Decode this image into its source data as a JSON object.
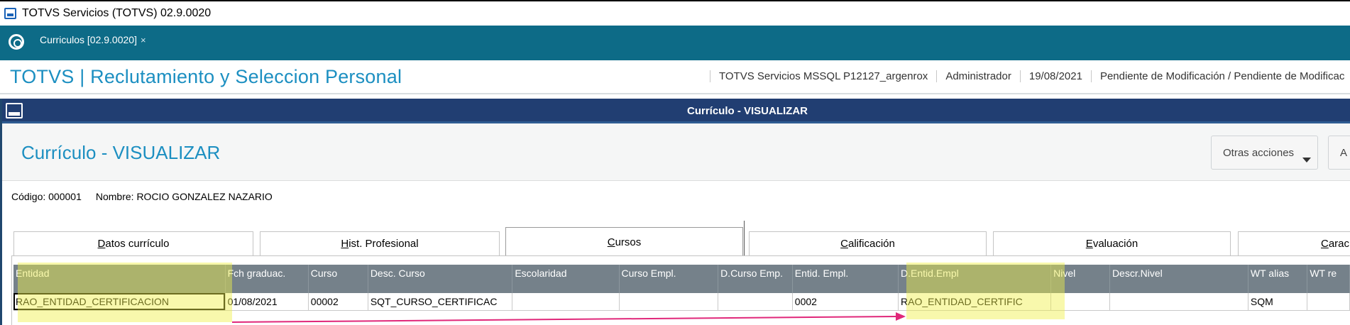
{
  "window": {
    "title": "TOTVS Servicios (TOTVS) 02.9.0020"
  },
  "tabs": [
    {
      "label": "Curriculos [02.9.0020]",
      "close": "×"
    }
  ],
  "header": {
    "app_title": "TOTVS | Reclutamiento y Seleccion Personal",
    "environment": "TOTVS Servicios MSSQL P12127_argenrox",
    "user": "Administrador",
    "date": "19/08/2021",
    "status": "Pendiente de Modificación / Pendiente de Modificac"
  },
  "dialog": {
    "title": "Currículo - VISUALIZAR",
    "form_title": "Currículo - VISUALIZAR",
    "buttons": {
      "otras_acciones": "Otras acciones",
      "a": "A"
    },
    "record": {
      "codigo": "Código: 000001",
      "nombre": "Nombre: ROCIO GONZALEZ NAZARIO"
    }
  },
  "folder_tabs": [
    {
      "pre": "",
      "key": "D",
      "post": "atos currículo",
      "active": false
    },
    {
      "pre": "",
      "key": "H",
      "post": "ist. Profesional",
      "active": false
    },
    {
      "pre": "",
      "key": "C",
      "post": "ursos",
      "active": true
    },
    {
      "pre": "",
      "key": "C",
      "post": "alificación",
      "active": false
    },
    {
      "pre": "",
      "key": "E",
      "post": "valuación",
      "active": false
    },
    {
      "pre": "",
      "key": "C",
      "post": "arac",
      "active": false
    }
  ],
  "grid": {
    "columns": [
      "Entidad",
      "Fch graduac.",
      "Curso",
      "Desc. Curso",
      "Escolaridad",
      "Curso Empl.",
      "D.Curso Emp.",
      "Entid. Empl.",
      "D.Entid.Empl",
      "Nivel",
      "Descr.Nivel",
      "WT alias",
      "WT re"
    ],
    "rows": [
      [
        "RAO_ENTIDAD_CERTIFICACION",
        "01/08/2021",
        "00002",
        "SQT_CURSO_CERTIFICAC",
        "",
        "",
        "",
        "0002",
        "RAO_ENTIDAD_CERTIFIC",
        "",
        "",
        "SQM",
        ""
      ]
    ]
  },
  "colors": {
    "tabstrip": "#0d6b87",
    "dialog_bar": "#213e72",
    "accent_title": "#1c8fc1",
    "grid_header": "#75818a",
    "highlight": "#eff046",
    "arrow": "#e0287a"
  }
}
